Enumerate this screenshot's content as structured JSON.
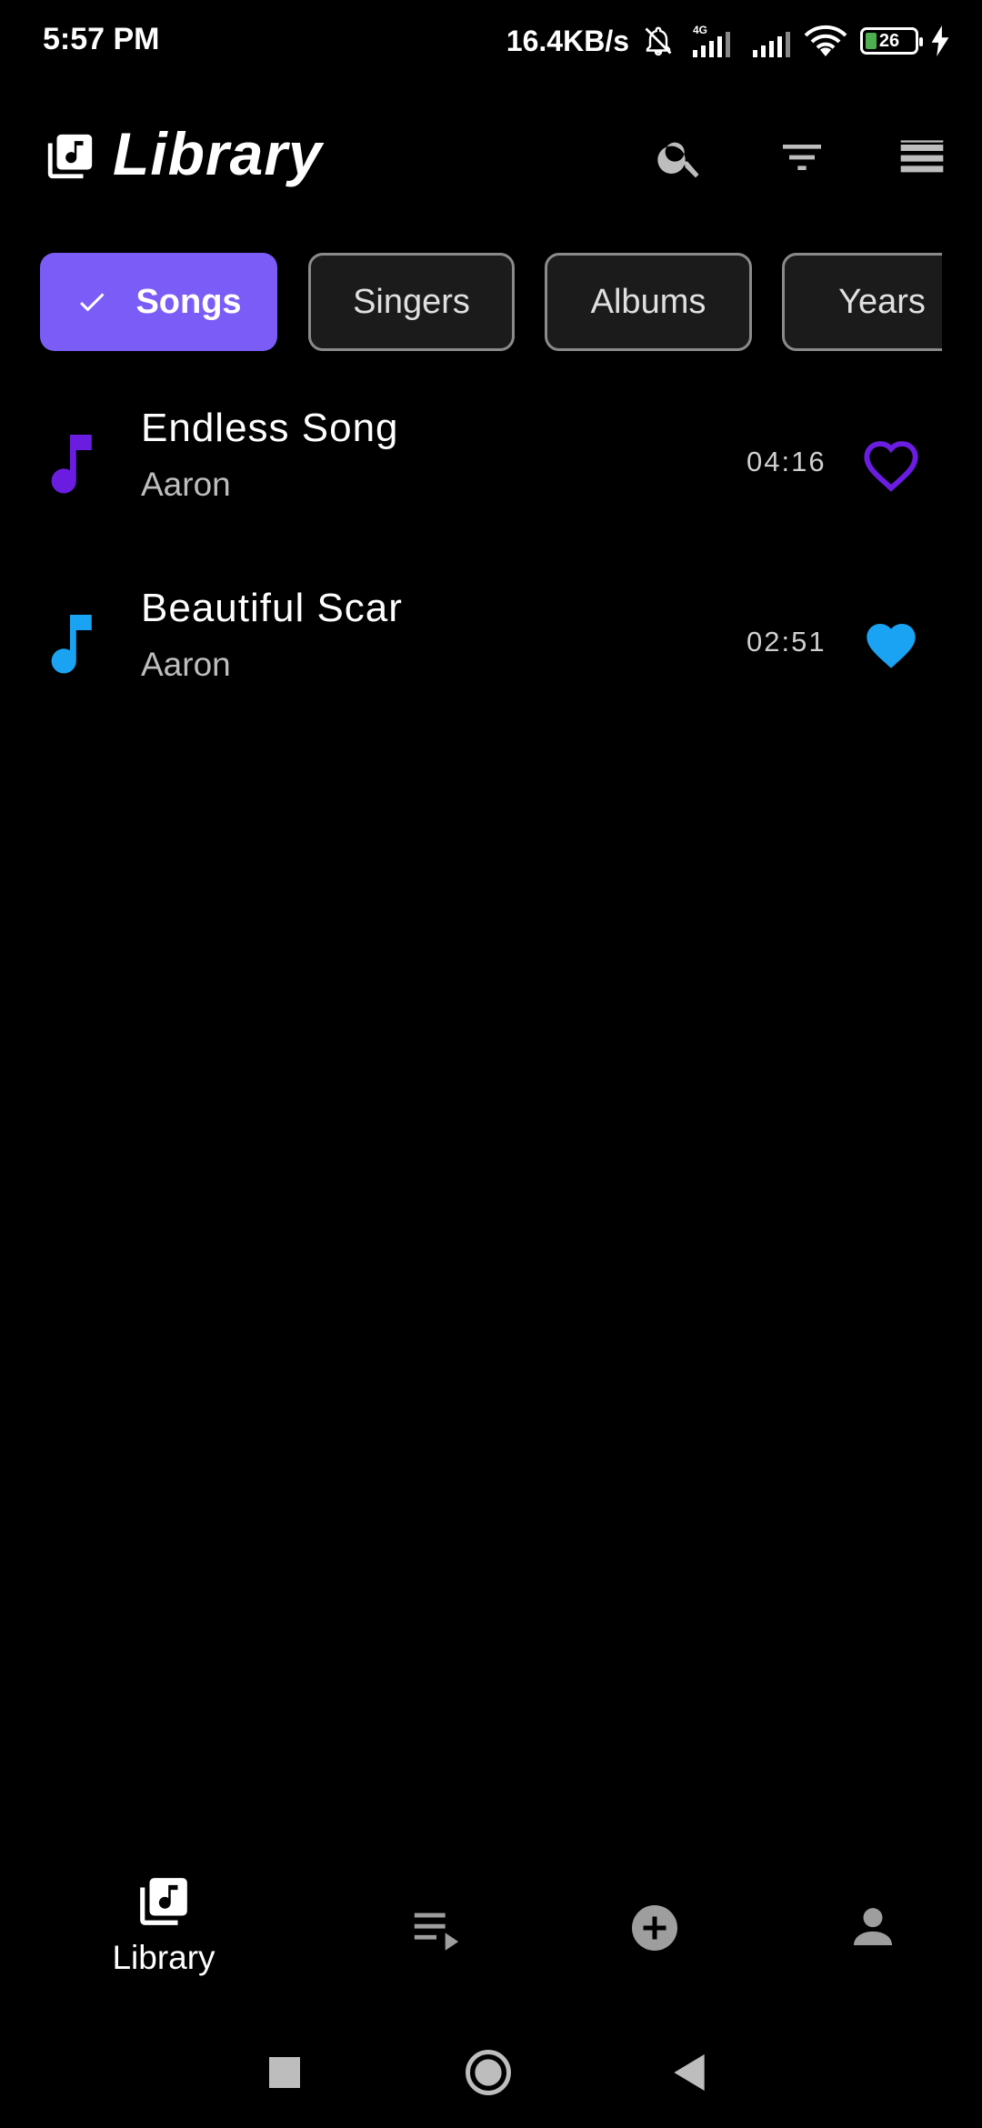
{
  "status_bar": {
    "time": "5:57 PM",
    "net_speed": "16.4KB/s",
    "network_type": "4G",
    "battery_level": "26",
    "icons": [
      "mute-bell-icon",
      "signal-4g-icon",
      "signal-icon",
      "wifi-icon",
      "battery-icon",
      "charging-icon"
    ]
  },
  "header": {
    "title": "Library",
    "actions": [
      "search-icon",
      "filter-icon",
      "view-list-icon"
    ]
  },
  "filter_chips": [
    {
      "label": "Songs",
      "selected": true
    },
    {
      "label": "Singers",
      "selected": false
    },
    {
      "label": "Albums",
      "selected": false
    },
    {
      "label": "Years",
      "selected": false
    }
  ],
  "songs": [
    {
      "title": "Endless Song",
      "artist": "Aaron",
      "duration": "04:16",
      "favorite": false,
      "color": "#6a1de0"
    },
    {
      "title": "Beautiful Scar",
      "artist": "Aaron",
      "duration": "02:51",
      "favorite": true,
      "color": "#1aa3f2"
    }
  ],
  "bottom_nav": {
    "items": [
      {
        "label": "Library",
        "icon": "library-icon",
        "active": true
      },
      {
        "label": "",
        "icon": "queue-play-icon",
        "active": false
      },
      {
        "label": "",
        "icon": "add-circle-icon",
        "active": false
      },
      {
        "label": "",
        "icon": "person-icon",
        "active": false
      }
    ]
  },
  "system_nav": [
    "recents-button",
    "home-button",
    "back-button"
  ],
  "colors": {
    "accent": "#7b5cf7",
    "background": "#000000",
    "chip_outline": "#8a8a8a"
  }
}
